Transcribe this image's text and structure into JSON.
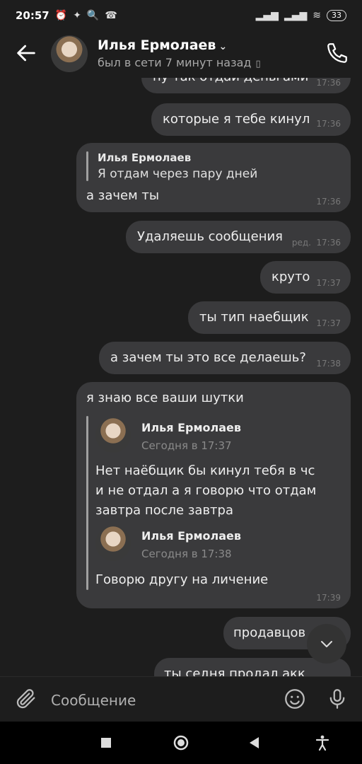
{
  "status_bar": {
    "time": "20:57",
    "battery": "33"
  },
  "header": {
    "contact_name": "Илья Ермолаев",
    "contact_status": "был в сети 7 минут назад"
  },
  "messages": [
    {
      "text": "ну так отдай деньгами",
      "time": "17:36"
    },
    {
      "text": "которые я тебе кинул",
      "time": "17:36"
    },
    {
      "reply_author": "Илья Ермолаев",
      "reply_text": "Я отдам через пару дней",
      "text": "а зачем ты",
      "time": "17:36"
    },
    {
      "text": "Удаляешь сообщения",
      "edited": "ред.",
      "time": "17:36"
    },
    {
      "text": "круто",
      "time": "17:37"
    },
    {
      "text": "ты тип наебщик",
      "time": "17:37"
    },
    {
      "text": "а зачем ты это все делаешь?",
      "time": "17:38"
    },
    {
      "text": "я знаю все ваши шутки",
      "time": "17:39",
      "forwards": [
        {
          "author": "Илья Ермолаев",
          "date": "Сегодня в 17:37",
          "lines": [
            "Нет наёбщик бы кинул тебя в чс",
            "и не отдал а я говорю что отдам",
            "завтра после завтра"
          ]
        },
        {
          "author": "Илья Ермолаев",
          "date": "Сегодня в 17:38",
          "lines": [
            "Говорю другу на личение"
          ]
        }
      ]
    },
    {
      "text": "продавцов",
      "time": ""
    },
    {
      "text": "ты седня продал акк",
      "time": ""
    }
  ],
  "composer": {
    "placeholder": "Сообщение"
  },
  "colors": {
    "background": "#1d1d1d",
    "bubble": "#3a3a3c",
    "timestamp": "#777777"
  },
  "icons": [
    "back-arrow-icon",
    "chevron-down-icon",
    "phone-icon",
    "paperclip-icon",
    "emoji-icon",
    "microphone-icon",
    "chevron-down-icon",
    "stop-square-icon",
    "home-circle-icon",
    "back-triangle-icon",
    "accessibility-icon"
  ]
}
